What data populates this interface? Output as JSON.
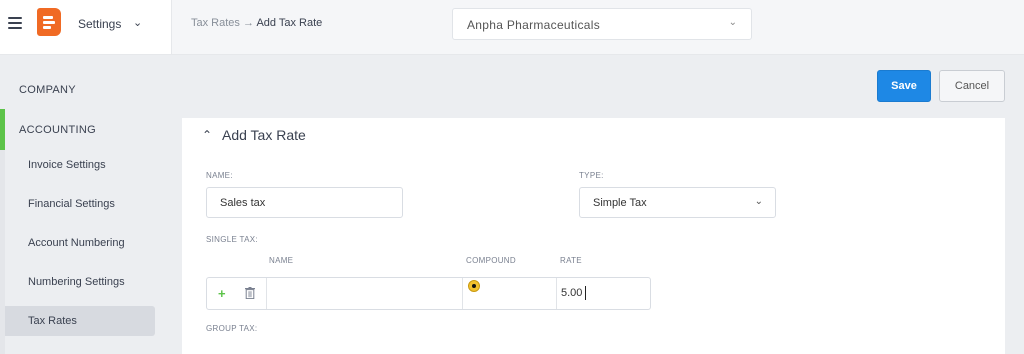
{
  "topbar": {
    "settings_label": "Settings",
    "settings_chevron": "⌄",
    "breadcrumb_parent": "Tax Rates",
    "breadcrumb_arrow": "→",
    "breadcrumb_current": "Add Tax Rate",
    "company_value": "Anpha Pharmaceuticals",
    "company_chevron": "⌄"
  },
  "icons": {
    "menu": "hamburger-icon",
    "logo": "app-logo-icon",
    "add": "plus-icon",
    "delete": "trash-icon",
    "collapse": "chevron-up-icon"
  },
  "sidebar": {
    "company_label": "COMPANY",
    "accounting_label": "ACCOUNTING",
    "items": [
      {
        "label": "Invoice Settings"
      },
      {
        "label": "Financial Settings"
      },
      {
        "label": "Account Numbering"
      },
      {
        "label": "Numbering Settings"
      },
      {
        "label": "Tax Rates",
        "active": true
      }
    ]
  },
  "actions": {
    "save_label": "Save",
    "cancel_label": "Cancel"
  },
  "form": {
    "title": "Add Tax Rate",
    "toggle_glyph": "⌃",
    "name_label": "NAME:",
    "name_value": "Sales tax",
    "type_label": "TYPE:",
    "type_value": "Simple Tax",
    "type_chevron": "⌄",
    "single_tax_label": "SINGLE TAX:",
    "columns": {
      "name": "NAME",
      "compound": "COMPOUND",
      "rate": "RATE"
    },
    "row": {
      "name": "",
      "compound": true,
      "rate": "5.00"
    },
    "plus_glyph": "+",
    "group_tax_label": "GROUP TAX:"
  },
  "colors": {
    "save_button": "#1e88e5",
    "accent_green": "#5cc349",
    "logo_orange": "#f06a24",
    "radio_yellow": "#f2c12e"
  }
}
